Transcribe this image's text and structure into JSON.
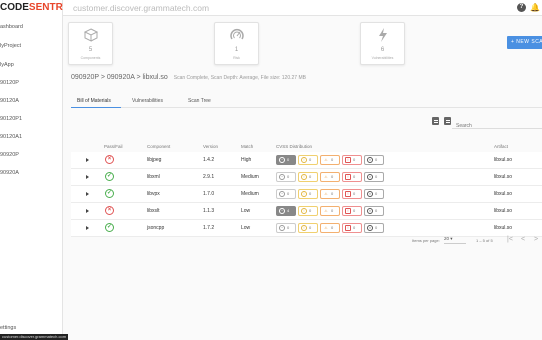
{
  "app": {
    "logo_main": "CODE",
    "logo_accent": "SENTRY",
    "url": "customer.discover.grammatech.com",
    "status_url": "customer.discover.grammatech.com"
  },
  "sidebar": {
    "items": [
      {
        "label": "ashboard"
      },
      {
        "label": "lyProject"
      },
      {
        "label": "lyApp"
      },
      {
        "label": "90120P"
      },
      {
        "label": "90120A"
      },
      {
        "label": "90120P1"
      },
      {
        "label": "90120A1"
      },
      {
        "label": "90920P"
      },
      {
        "label": "90920A"
      }
    ],
    "settings": "ettings"
  },
  "cards": [
    {
      "number": "5",
      "label": "Components",
      "icon": "cube-icon"
    },
    {
      "number": "1",
      "label": "Risk",
      "icon": "gauge-icon"
    },
    {
      "number": "6",
      "label": "Vulnerabilities",
      "icon": "bolt-icon"
    }
  ],
  "new_button": "+ NEW SCAN",
  "breadcrumb": {
    "path": "090920P > 090920A > libxul.so",
    "meta": "Scan Complete, Scan Depth: Average, File size: 120.27 MB"
  },
  "tabs": [
    {
      "label": "Bill of Materials",
      "active": true
    },
    {
      "label": "Vulnerabilities",
      "active": false
    },
    {
      "label": "Scan Tree",
      "active": false
    }
  ],
  "search": {
    "placeholder": "Search"
  },
  "table": {
    "headers": {
      "passfail": "Pass/Fail",
      "component": "Component",
      "version": "Version",
      "match": "Match",
      "cvss": "CVSS Distribution",
      "artifact": "Artifact"
    },
    "rows": [
      {
        "status": "fail",
        "component": "libjpeg",
        "version": "1.4.2",
        "match": "High",
        "cvss": [
          "0",
          "0",
          "0",
          "0",
          "0"
        ],
        "first_filled": true,
        "artifact": "libxul.so"
      },
      {
        "status": "pass",
        "component": "libxml",
        "version": "2.9.1",
        "match": "Medium",
        "cvss": [
          "0",
          "0",
          "0",
          "0",
          "0"
        ],
        "first_filled": false,
        "artifact": "libxul.so"
      },
      {
        "status": "pass",
        "component": "libvpx",
        "version": "1.7.0",
        "match": "Medium",
        "cvss": [
          "0",
          "0",
          "0",
          "0",
          "0"
        ],
        "first_filled": false,
        "artifact": "libxul.so"
      },
      {
        "status": "fail",
        "component": "libxslt",
        "version": "1.1.3",
        "match": "Low",
        "cvss": [
          "4",
          "0",
          "0",
          "0",
          "0"
        ],
        "first_filled": true,
        "artifact": "libxul.so"
      },
      {
        "status": "pass",
        "component": "jsoncpp",
        "version": "1.7.2",
        "match": "Low",
        "cvss": [
          "0",
          "0",
          "0",
          "0",
          "0"
        ],
        "first_filled": false,
        "artifact": "libxul.so"
      }
    ]
  },
  "pagination": {
    "rows_label": "Items per page:",
    "rows_value": "20",
    "range": "1 – 5 of 5"
  },
  "colors": {
    "accent": "#4a90e2",
    "fail": "#e05555",
    "pass": "#4caf50",
    "logo_accent": "#e8452a"
  }
}
